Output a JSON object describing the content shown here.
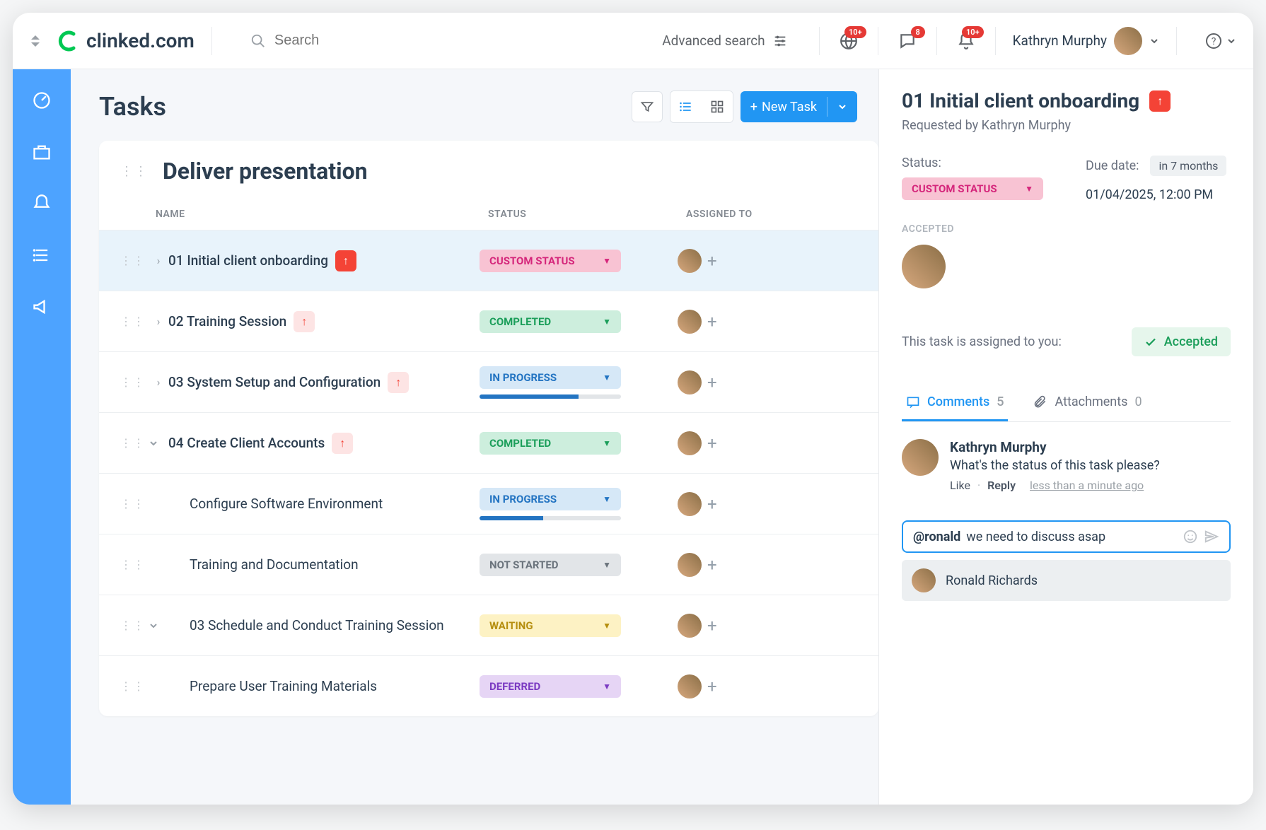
{
  "logo": "clinked.com",
  "search_placeholder": "Search",
  "advanced_search": "Advanced search",
  "badges": {
    "globe": "10+",
    "chat": "8",
    "bell": "10+"
  },
  "user_name": "Kathryn Murphy",
  "page_title": "Tasks",
  "new_task_label": "New Task",
  "section_title": "Deliver presentation",
  "columns": {
    "name": "NAME",
    "status": "STATUS",
    "assigned": "ASSIGNED TO"
  },
  "statuses": {
    "custom": "CUSTOM STATUS",
    "completed": "COMPLETED",
    "inprogress": "IN PROGRESS",
    "notstarted": "NOT STARTED",
    "waiting": "WAITING",
    "deferred": "DEFERRED"
  },
  "tasks": [
    {
      "name": "01 Initial client onboarding",
      "status": "custom",
      "chev": "›",
      "priority": "red"
    },
    {
      "name": "02 Training Session",
      "status": "completed",
      "chev": "›",
      "priority": "pink"
    },
    {
      "name": "03 System Setup and Configuration",
      "status": "inprogress",
      "chev": "›",
      "priority": "pink",
      "progress": 70
    },
    {
      "name": "04 Create Client Accounts",
      "status": "completed",
      "chev": "v",
      "priority": "pink"
    },
    {
      "name": "Configure Software Environment",
      "status": "inprogress",
      "sub": true,
      "progress": 45
    },
    {
      "name": "Training and Documentation",
      "status": "notstarted",
      "sub": true
    },
    {
      "name": "03 Schedule and Conduct Training Session",
      "status": "waiting",
      "chev": "v",
      "sub": true
    },
    {
      "name": "Prepare User Training Materials",
      "status": "deferred",
      "sub": true
    }
  ],
  "detail": {
    "title": "01 Initial client onboarding",
    "requested_by": "Requested by Kathryn Murphy",
    "status_label": "Status:",
    "status": "CUSTOM STATUS",
    "due_label": "Due date:",
    "due_chip": "in 7 months",
    "due_date": "01/04/2025, 12:00 PM",
    "accepted_label": "ACCEPTED",
    "assign_text": "This task is assigned to you:",
    "accepted_text": "Accepted",
    "tabs": {
      "comments_label": "Comments",
      "comments_count": "5",
      "attachments_label": "Attachments",
      "attachments_count": "0"
    },
    "comment": {
      "author": "Kathryn Murphy",
      "text": "What's the status of this task please?",
      "like": "Like",
      "reply": "Reply",
      "time": "less than a minute ago"
    },
    "compose": {
      "mention": "@ronald",
      "text": "we need to discuss asap"
    },
    "suggestion": "Ronald Richards"
  }
}
